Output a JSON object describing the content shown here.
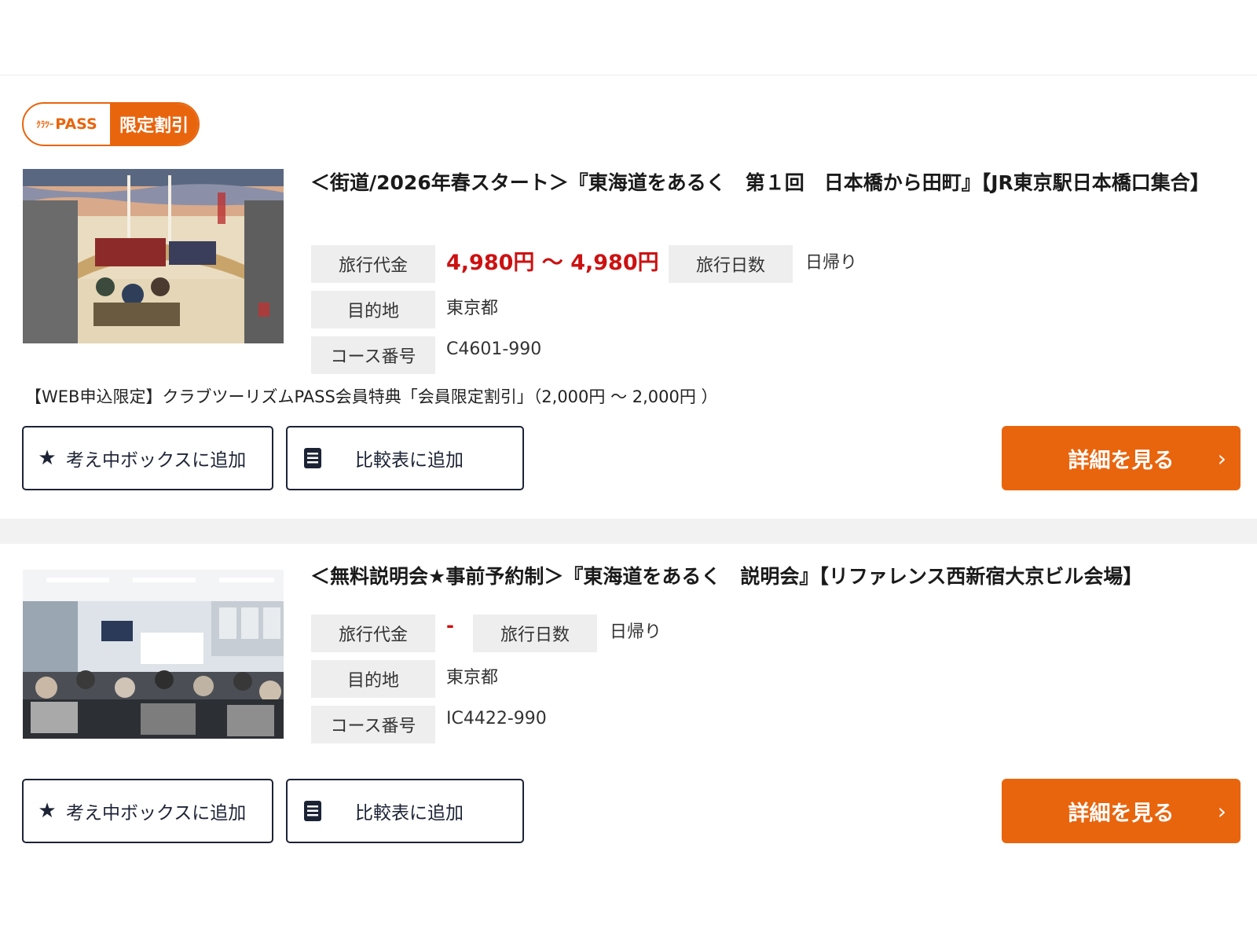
{
  "colors": {
    "accent": "#e8650e",
    "price": "#cc1111",
    "label_bg": "#eeeeee",
    "button_border": "#1c2335"
  },
  "common": {
    "favorite_label": "考え中ボックスに追加",
    "compare_label": "比較表に追加",
    "detail_label": "詳細を見る",
    "chevron": "›",
    "star": "★"
  },
  "labels": {
    "price": "旅行代金",
    "days": "旅行日数",
    "destination": "目的地",
    "course_no": "コース番号"
  },
  "tours": [
    {
      "badge": {
        "logo_small": "ｸﾗﾂｰ",
        "logo_text": "PASS",
        "tag": "限定割引"
      },
      "title": "＜街道/2026年春スタート＞『東海道をあるく　第１回　日本橋から田町』【JR東京駅日本橋口集合】",
      "price": "4,980円 ～ 4,980円",
      "days": "日帰り",
      "destination": "東京都",
      "course_no": "C4601-990",
      "note": "【WEB申込限定】クラブツーリズムPASS会員特典「会員限定割引」（2,000円 ～ 2,000円 ）"
    },
    {
      "title": "＜無料説明会★事前予約制＞『東海道をあるく　説明会』【リファレンス西新宿大京ビル会場】",
      "price": "-",
      "days": "日帰り",
      "destination": "東京都",
      "course_no": "IC4422-990"
    }
  ]
}
